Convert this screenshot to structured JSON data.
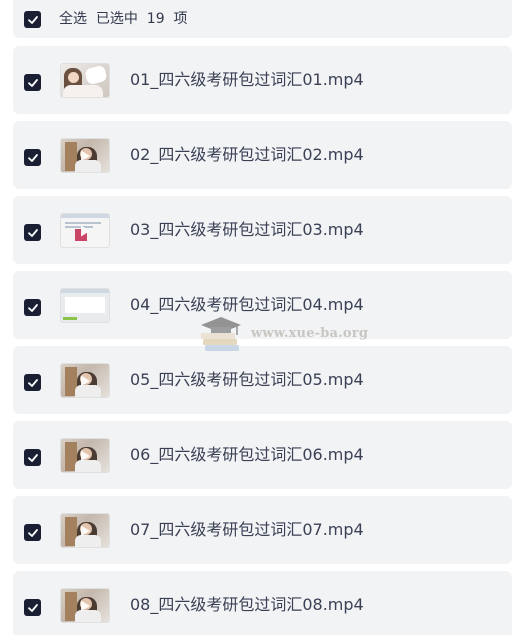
{
  "header": {
    "select_all": "全选  已选中  19  项",
    "checkbox_checked": true
  },
  "files": [
    {
      "name": "01_四六级考研包过词汇01.mp4",
      "checked": true,
      "thumb": "person-room"
    },
    {
      "name": "02_四六级考研包过词汇02.mp4",
      "checked": true,
      "thumb": "person-light"
    },
    {
      "name": "03_四六级考研包过词汇03.mp4",
      "checked": true,
      "thumb": "screen-slide"
    },
    {
      "name": "04_四六级考研包过词汇04.mp4",
      "checked": true,
      "thumb": "screen-software"
    },
    {
      "name": "05_四六级考研包过词汇05.mp4",
      "checked": true,
      "thumb": "person-room"
    },
    {
      "name": "06_四六级考研包过词汇06.mp4",
      "checked": true,
      "thumb": "person-room"
    },
    {
      "name": "07_四六级考研包过词汇07.mp4",
      "checked": true,
      "thumb": "person-room"
    },
    {
      "name": "08_四六级考研包过词汇08.mp4",
      "checked": true,
      "thumb": "person-room"
    }
  ],
  "watermark": {
    "text": "www.xue-ba.org"
  },
  "colors": {
    "row_bg": "#f2f3f5",
    "checkbox": "#1a1f33",
    "text": "#3a4155"
  }
}
